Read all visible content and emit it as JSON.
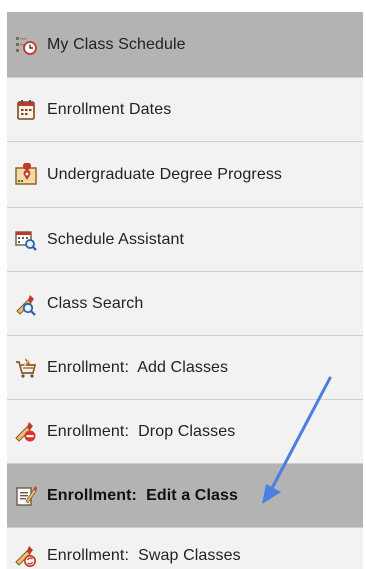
{
  "menu": {
    "items": [
      {
        "label": "My Class Schedule",
        "icon": "schedule-clock-icon",
        "state": "selected"
      },
      {
        "label": "Enrollment Dates",
        "icon": "calendar-icon",
        "state": "normal"
      },
      {
        "label": "Undergraduate Degree Progress",
        "icon": "degree-progress-icon",
        "state": "normal"
      },
      {
        "label": "Schedule Assistant",
        "icon": "schedule-search-icon",
        "state": "normal"
      },
      {
        "label": "Class Search",
        "icon": "class-search-icon",
        "state": "normal"
      },
      {
        "label": "Enrollment:  Add Classes",
        "icon": "cart-add-icon",
        "state": "normal"
      },
      {
        "label": "Enrollment:  Drop Classes",
        "icon": "drop-class-icon",
        "state": "normal"
      },
      {
        "label": "Enrollment:  Edit a Class",
        "icon": "edit-class-icon",
        "state": "current"
      },
      {
        "label": "Enrollment:  Swap Classes",
        "icon": "swap-class-icon",
        "state": "normal"
      }
    ]
  },
  "colors": {
    "selected_bg": "#b3b3b3",
    "item_bg": "#f2f2f2",
    "arrow": "#4a7ee0"
  }
}
